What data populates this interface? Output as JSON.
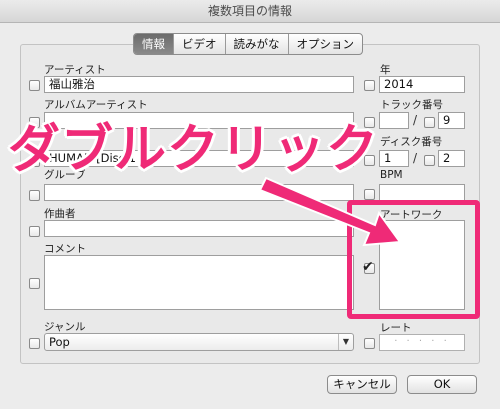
{
  "window": {
    "title": "複数項目の情報"
  },
  "tabs": [
    {
      "label": "情報",
      "active": true
    },
    {
      "label": "ビデオ",
      "active": false
    },
    {
      "label": "読みがな",
      "active": false
    },
    {
      "label": "オプション",
      "active": false
    }
  ],
  "fields": {
    "artist": {
      "label": "アーティスト",
      "value": "福山雅治"
    },
    "album_artist": {
      "label": "アルバムアーティスト",
      "value": ""
    },
    "album": {
      "label": "",
      "value": "HUMAN [Disc 1"
    },
    "grouping": {
      "label": "グルーブ",
      "value": ""
    },
    "composer": {
      "label": "作曲者",
      "value": ""
    },
    "comment": {
      "label": "コメント",
      "value": ""
    },
    "genre": {
      "label": "ジャンル",
      "value": "Pop"
    },
    "year": {
      "label": "年",
      "value": "2014"
    },
    "track": {
      "label": "トラック番号",
      "number": "",
      "total": "9"
    },
    "disc": {
      "label": "ディスク番号",
      "number": "1",
      "total": "2"
    },
    "bpm": {
      "label": "BPM",
      "value": ""
    },
    "artwork": {
      "label": "アートワーク",
      "checked": true
    },
    "rating": {
      "label": "レート",
      "value": "· · · · ·"
    }
  },
  "buttons": {
    "cancel": "キャンセル",
    "ok": "OK"
  },
  "annotation": {
    "text": "ダブルクリック",
    "color": "#ef2a77"
  }
}
